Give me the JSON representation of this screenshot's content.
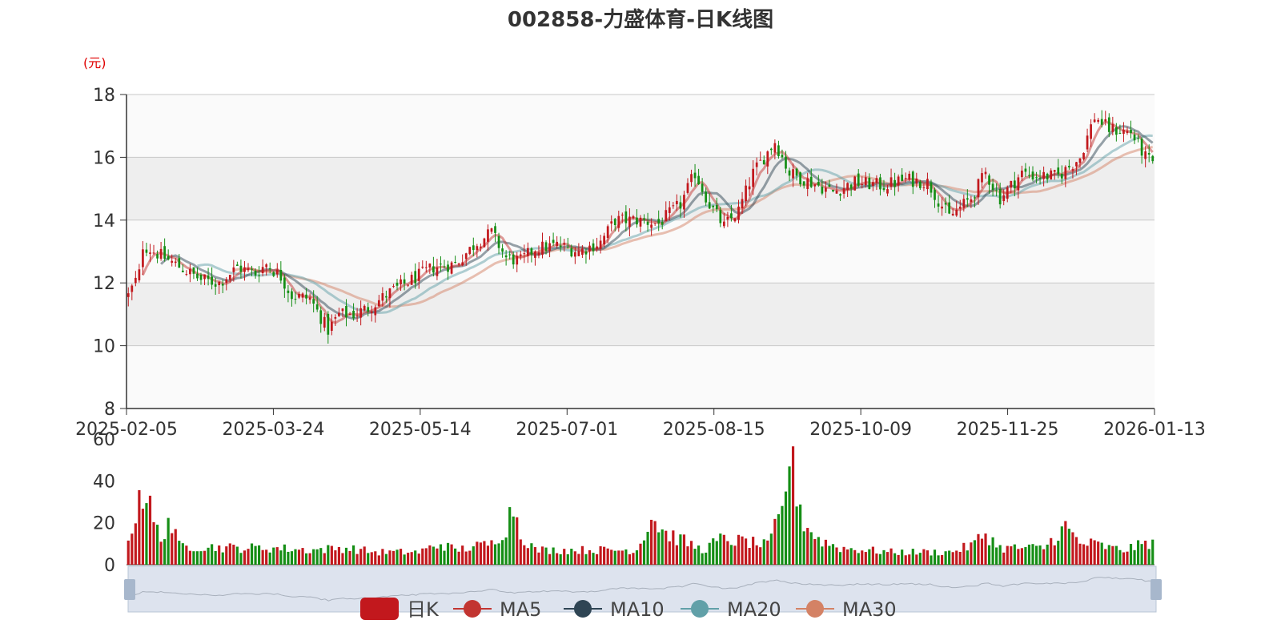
{
  "title": "002858-力盛体育-日K线图",
  "unit_label": "(元)",
  "colors": {
    "up": "#c2181d",
    "down": "#158e15",
    "ma5": "#c23531",
    "ma10": "#2f4554",
    "ma20": "#61a0a8",
    "ma30": "#d48265",
    "grid": "#c8c8c8",
    "band_dark": "#eeeeee",
    "band_light": "#fafafa",
    "slider_bg": "#dde3ee"
  },
  "legend": [
    {
      "label": "日K",
      "color": "#c2181d",
      "icon": "rounded-rect-icon"
    },
    {
      "label": "MA5",
      "color": "#c23531",
      "icon": "line-circle-icon"
    },
    {
      "label": "MA10",
      "color": "#2f4554",
      "icon": "line-circle-icon"
    },
    {
      "label": "MA20",
      "color": "#61a0a8",
      "icon": "line-circle-icon"
    },
    {
      "label": "MA30",
      "color": "#d48265",
      "icon": "line-circle-icon"
    }
  ],
  "chart_data": {
    "type": "candlestick",
    "x_tick_labels": [
      "2025-02-05",
      "2025-03-24",
      "2025-05-14",
      "2025-07-01",
      "2025-08-15",
      "2025-10-09",
      "2025-11-25",
      "2026-01-13"
    ],
    "price_axis": {
      "min": 8,
      "max": 18,
      "ticks": [
        8,
        10,
        12,
        14,
        16,
        18
      ]
    },
    "volume_axis": {
      "min": 0,
      "max": 60,
      "ticks": [
        0,
        20,
        40,
        60
      ]
    },
    "close_anchors": [
      [
        0,
        11.6
      ],
      [
        3,
        12.3
      ],
      [
        4,
        13.2
      ],
      [
        10,
        12.8
      ],
      [
        20,
        12.1
      ],
      [
        25,
        12.0
      ],
      [
        30,
        12.5
      ],
      [
        35,
        12.3
      ],
      [
        38,
        12.6
      ],
      [
        42,
        12.2
      ],
      [
        45,
        11.6
      ],
      [
        50,
        11.5
      ],
      [
        55,
        10.5
      ],
      [
        58,
        11.0
      ],
      [
        62,
        11.0
      ],
      [
        66,
        11.2
      ],
      [
        72,
        11.7
      ],
      [
        78,
        12.1
      ],
      [
        84,
        12.5
      ],
      [
        90,
        12.6
      ],
      [
        96,
        13.3
      ],
      [
        100,
        13.6
      ],
      [
        104,
        12.8
      ],
      [
        108,
        12.7
      ],
      [
        112,
        13.1
      ],
      [
        118,
        13.2
      ],
      [
        124,
        13.0
      ],
      [
        130,
        13.3
      ],
      [
        134,
        14.0
      ],
      [
        140,
        14.0
      ],
      [
        146,
        13.9
      ],
      [
        152,
        14.5
      ],
      [
        156,
        15.5
      ],
      [
        160,
        14.5
      ],
      [
        164,
        13.8
      ],
      [
        168,
        14.3
      ],
      [
        172,
        15.5
      ],
      [
        178,
        16.5
      ],
      [
        182,
        15.5
      ],
      [
        188,
        15.2
      ],
      [
        194,
        14.9
      ],
      [
        200,
        15.2
      ],
      [
        208,
        15.1
      ],
      [
        214,
        15.3
      ],
      [
        220,
        15.2
      ],
      [
        226,
        14.1
      ],
      [
        232,
        14.7
      ],
      [
        236,
        15.5
      ],
      [
        240,
        14.7
      ],
      [
        246,
        15.5
      ],
      [
        250,
        15.4
      ],
      [
        256,
        15.4
      ],
      [
        262,
        16.0
      ],
      [
        266,
        17.3
      ],
      [
        270,
        16.9
      ],
      [
        276,
        16.8
      ],
      [
        280,
        16.0
      ],
      [
        282,
        15.8
      ]
    ],
    "volume_anchors": [
      [
        0,
        9
      ],
      [
        3,
        35
      ],
      [
        5,
        33
      ],
      [
        7,
        20
      ],
      [
        9,
        12
      ],
      [
        11,
        22
      ],
      [
        14,
        9
      ],
      [
        30,
        8
      ],
      [
        40,
        8
      ],
      [
        50,
        7
      ],
      [
        60,
        8
      ],
      [
        68,
        6
      ],
      [
        80,
        6
      ],
      [
        86,
        10
      ],
      [
        90,
        7
      ],
      [
        100,
        10
      ],
      [
        104,
        18
      ],
      [
        106,
        29
      ],
      [
        108,
        15
      ],
      [
        112,
        7
      ],
      [
        130,
        7
      ],
      [
        140,
        7
      ],
      [
        144,
        23
      ],
      [
        148,
        15
      ],
      [
        152,
        12
      ],
      [
        158,
        7
      ],
      [
        163,
        12
      ],
      [
        170,
        11
      ],
      [
        176,
        9
      ],
      [
        180,
        25
      ],
      [
        182,
        53
      ],
      [
        184,
        36
      ],
      [
        186,
        20
      ],
      [
        190,
        12
      ],
      [
        196,
        8
      ],
      [
        210,
        6
      ],
      [
        226,
        6
      ],
      [
        232,
        9
      ],
      [
        236,
        15
      ],
      [
        240,
        8
      ],
      [
        252,
        8
      ],
      [
        258,
        18
      ],
      [
        262,
        10
      ],
      [
        266,
        10
      ],
      [
        270,
        8
      ],
      [
        274,
        7
      ],
      [
        278,
        9
      ],
      [
        282,
        11
      ]
    ],
    "bar_count": 283,
    "ma_periods": [
      5,
      10,
      20,
      30
    ]
  }
}
